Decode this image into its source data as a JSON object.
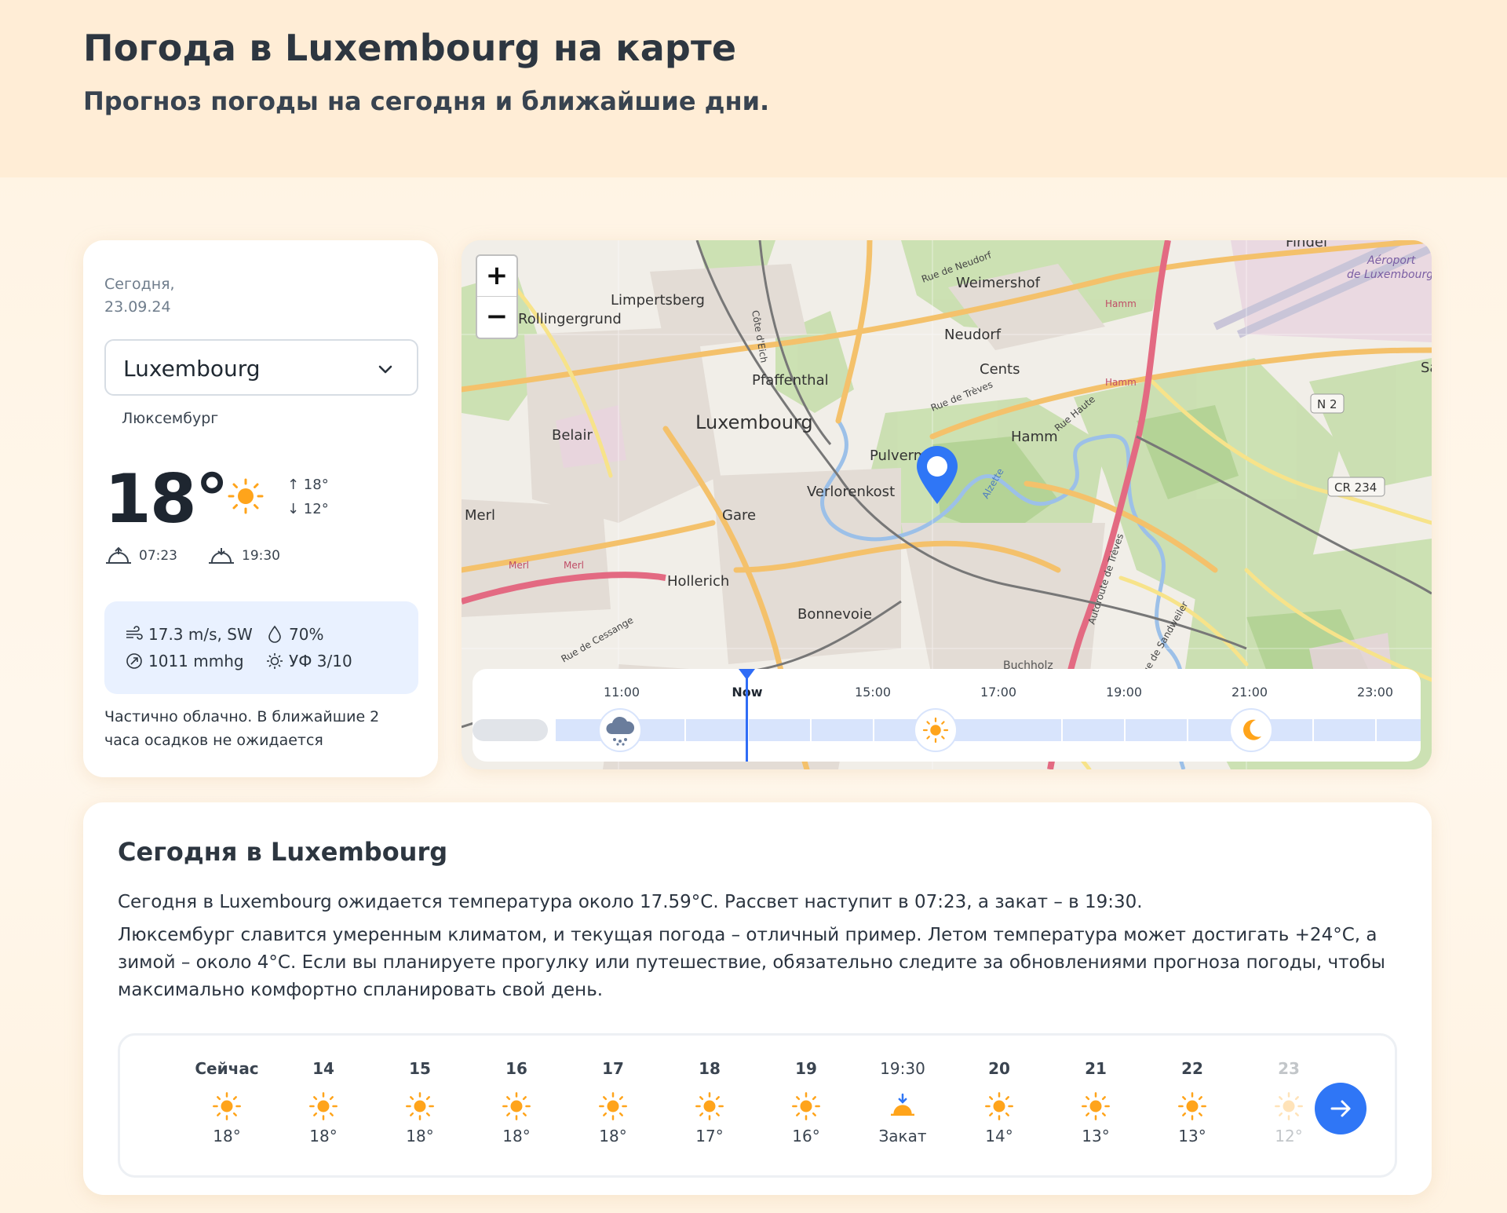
{
  "header": {
    "title": "Погода в Luxembourg на карте",
    "subtitle": "Прогноз погоды на сегодня и ближайшие дни."
  },
  "today_card": {
    "date": "Сегодня,\n23.09.24",
    "city": "Luxembourg",
    "country": "Люксембург",
    "temp": "18°",
    "icon": "sun-icon",
    "high": "↑ 18°",
    "low": "↓ 12°",
    "sunrise": "07:23",
    "sunset": "19:30",
    "wind": "17.3 m/s, SW",
    "humidity": "70%",
    "pressure": "1011 mmhg",
    "uv": "УФ 3/10",
    "description": "Частично облачно. В ближайшие 2 часа осадков не ожидается"
  },
  "map": {
    "zoom_in": "+",
    "zoom_out": "−",
    "places": [
      "Weimershof",
      "Rue de Neudorf",
      "Limpertsberg",
      "Côte d'Eich",
      "Rollingergrund",
      "Neudorf",
      "Cents",
      "Pfaffenthal",
      "Luxembourg",
      "Belair",
      "Hamm",
      "Pulvermühle",
      "Verlorenkost",
      "Merl",
      "Gare",
      "Hollerich",
      "Bonnevoie",
      "Hamm",
      "Hamm",
      "Findel",
      "Aéroport de Luxembourg",
      "N 2",
      "CR 234",
      "Rue de Trèves",
      "Rue Haute",
      "Autoroute de Trèves",
      "Rue de Cessange",
      "Rue de Sandweiler",
      "Merl",
      "Merl",
      "Buchholz",
      "Alzette",
      "Sa"
    ],
    "timeline": {
      "labels": [
        "11:00",
        "Now",
        "15:00",
        "17:00",
        "19:00",
        "21:00",
        "23:00"
      ],
      "icons": [
        "rain-cloud-icon",
        "sun-icon",
        "moon-icon"
      ]
    }
  },
  "today_text": {
    "heading": "Сегодня в Luxembourg",
    "p1": "Сегодня в Luxembourg ожидается температура около 17.59°С. Рассвет наступит в 07:23, а закат – в 19:30.",
    "p2": "Люксембург славится умеренным климатом, и текущая погода – отличный пример. Летом температура может достигать +24°C, а зимой – около 4°C. Если вы планируете прогулку или путешествие, обязательно следите за обновлениями прогноза погоды, чтобы максимально комфортно спланировать свой день."
  },
  "hourly": [
    {
      "hour": "Сейчас",
      "icon": "sun-icon",
      "temp": "18°"
    },
    {
      "hour": "14",
      "icon": "sun-icon",
      "temp": "18°"
    },
    {
      "hour": "15",
      "icon": "sun-icon",
      "temp": "18°"
    },
    {
      "hour": "16",
      "icon": "sun-icon",
      "temp": "18°"
    },
    {
      "hour": "17",
      "icon": "sun-icon",
      "temp": "18°"
    },
    {
      "hour": "18",
      "icon": "sun-icon",
      "temp": "17°"
    },
    {
      "hour": "19",
      "icon": "sun-icon",
      "temp": "16°"
    },
    {
      "hour": "19:30",
      "icon": "sunset-icon",
      "temp": "Закат"
    },
    {
      "hour": "20",
      "icon": "sun-icon",
      "temp": "14°"
    },
    {
      "hour": "21",
      "icon": "sun-icon",
      "temp": "13°"
    },
    {
      "hour": "22",
      "icon": "sun-icon",
      "temp": "13°"
    },
    {
      "hour": "23",
      "icon": "sun-icon",
      "temp": "12°"
    }
  ],
  "colors": {
    "accent": "#2f76f6",
    "sun": "#ffa41b",
    "hero_bg": "#ffedd6"
  }
}
